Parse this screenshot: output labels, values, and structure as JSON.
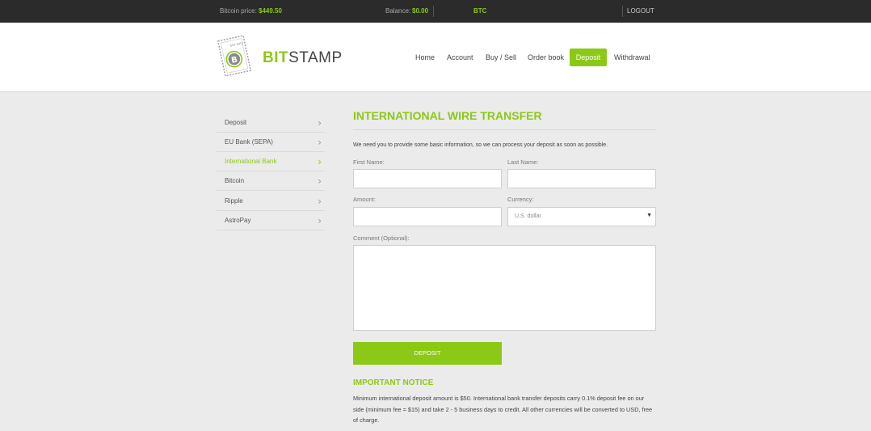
{
  "topbar": {
    "price_label": "Bitcoin price:",
    "price_value": "$449.50",
    "balance_label": "Balance:",
    "balance_value": "$0.00",
    "currency": "BTC",
    "logout": "LOGOUT"
  },
  "logo": {
    "bit": "BIT",
    "stamp": "STAMP",
    "stamp_est": "EST 2011"
  },
  "nav": {
    "home": "Home",
    "account": "Account",
    "buy_sell": "Buy / Sell",
    "order_book": "Order book",
    "deposit": "Deposit",
    "withdrawal": "Withdrawal"
  },
  "sidebar": {
    "items": [
      {
        "label": "Deposit"
      },
      {
        "label": "EU Bank (SEPA)"
      },
      {
        "label": "International Bank"
      },
      {
        "label": "Bitcoin"
      },
      {
        "label": "Ripple"
      },
      {
        "label": "AstroPay"
      }
    ]
  },
  "form": {
    "title": "INTERNATIONAL WIRE TRANSFER",
    "intro": "We need you to provide some basic information, so we can process your deposit as soon as possible.",
    "first_name_label": "First Name:",
    "first_name_value": "",
    "last_name_label": "Last Name:",
    "last_name_value": "",
    "amount_label": "Amount:",
    "amount_value": "",
    "currency_label": "Currency:",
    "currency_selected": "U.S. dollar",
    "comment_label": "Comment (Optional):",
    "comment_value": "",
    "submit_label": "DEPOSIT"
  },
  "notice": {
    "title": "IMPORTANT NOTICE",
    "text": "Minimum international deposit amount is $50. International bank transfer deposits carry 0.1% deposit fee on our side (minimum fee = $15) and take 2 - 5 business days to credit. All other currencies will be converted to USD, free of charge."
  },
  "colors": {
    "accent": "#8cc816",
    "topbar_bg": "#2b2b2b",
    "page_bg": "#ebebeb"
  }
}
